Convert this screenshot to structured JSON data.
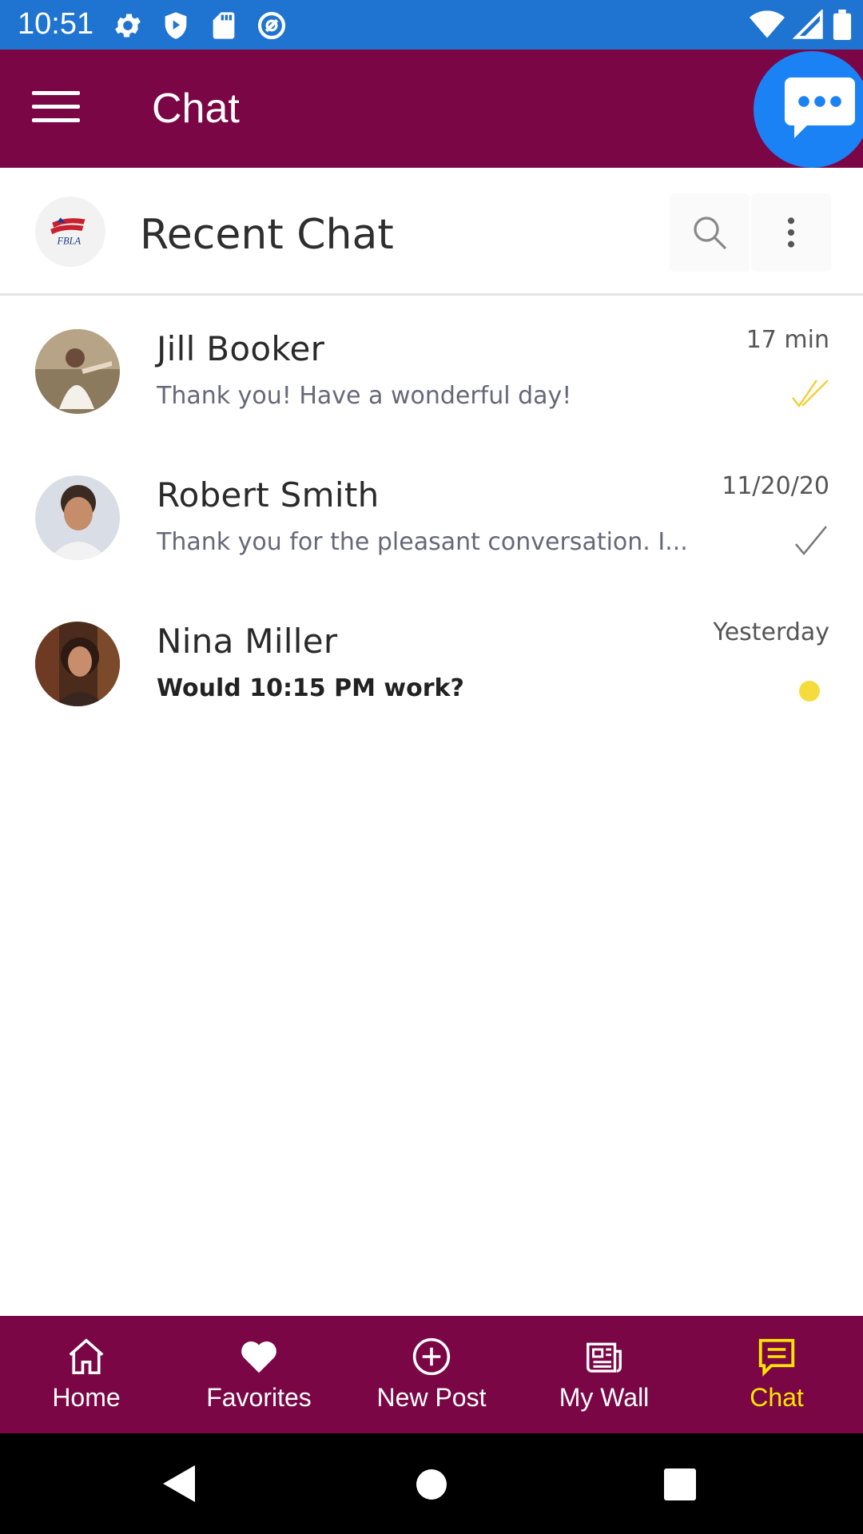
{
  "status_bar": {
    "time": "10:51"
  },
  "app_bar": {
    "title": "Chat"
  },
  "header": {
    "title": "Recent Chat",
    "logo_text": "FBLA"
  },
  "chats": [
    {
      "name": "Jill Booker",
      "message": "Thank you! Have a wonderful day!",
      "time": "17 min",
      "status": "read"
    },
    {
      "name": "Robert Smith",
      "message": "Thank you for the pleasant conversation. I...",
      "time": "11/20/20",
      "status": "sent"
    },
    {
      "name": "Nina Miller",
      "message": "Would 10:15 PM work?",
      "time": "Yesterday",
      "status": "unread"
    }
  ],
  "bottom_nav": {
    "items": [
      {
        "label": "Home",
        "icon": "home-icon"
      },
      {
        "label": "Favorites",
        "icon": "heart-icon"
      },
      {
        "label": "New Post",
        "icon": "plus-circle-icon"
      },
      {
        "label": "My Wall",
        "icon": "newspaper-icon"
      },
      {
        "label": "Chat",
        "icon": "chat-icon",
        "active": true
      }
    ]
  },
  "colors": {
    "status_bar": "#1e74d0",
    "brand": "#7a0645",
    "fab": "#1a82f4",
    "accent": "#ffe600"
  }
}
